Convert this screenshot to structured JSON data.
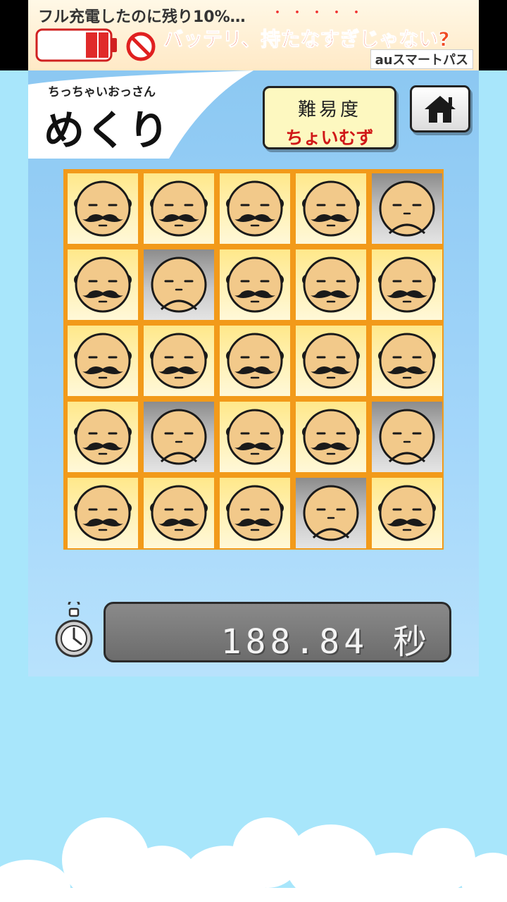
{
  "ad": {
    "line1": "フル充電したのに残り10%…",
    "dots": "・・・・・",
    "line2": "バッテリ、持たなすぎじゃない?",
    "brand": "auスマートパス"
  },
  "header": {
    "logo_subtitle": "ちっちゃいおっさん",
    "logo_title": "めくり",
    "difficulty_label": "難易度",
    "difficulty_value": "ちょいむず",
    "home_icon": "home-icon"
  },
  "board": {
    "rows": 5,
    "cols": 5,
    "tiles": [
      [
        "mustache",
        "mustache",
        "mustache",
        "mustache",
        "sad"
      ],
      [
        "mustache",
        "sad",
        "mustache",
        "mustache",
        "mustache"
      ],
      [
        "mustache",
        "mustache",
        "mustache",
        "mustache",
        "mustache"
      ],
      [
        "mustache",
        "sad",
        "mustache",
        "mustache",
        "sad"
      ],
      [
        "mustache",
        "mustache",
        "mustache",
        "sad",
        "mustache"
      ]
    ]
  },
  "timer": {
    "value": "188.84 秒",
    "icon": "stopwatch-icon"
  },
  "colors": {
    "sky": "#a8e6fb",
    "board_border": "#f29a1a",
    "face": "#f2c98a",
    "difficulty_value": "#d01818"
  }
}
